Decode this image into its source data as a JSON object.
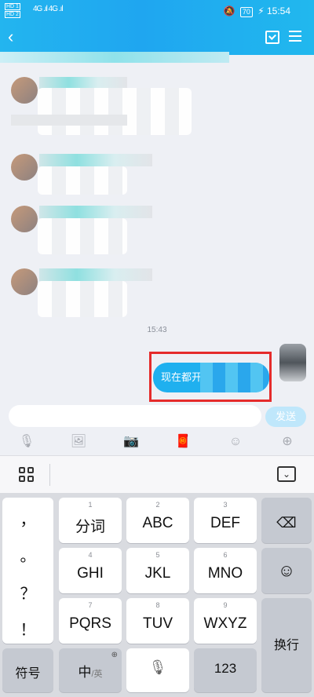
{
  "status": {
    "sim1": "HD 1",
    "sim2": "HD 2",
    "signal": "4G .ıl 4G .ıl",
    "battery": "70",
    "time": "15:54"
  },
  "nav": {
    "back": "‹"
  },
  "chat": {
    "timestamp": "15:43",
    "sent_message": "现在都开"
  },
  "input": {
    "placeholder": "",
    "send_label": "发送"
  },
  "toolbar": [
    "mic-icon",
    "image-icon",
    "camera-icon",
    "red-packet-icon",
    "emoji-icon",
    "plus-icon"
  ],
  "keyboard": {
    "punct": [
      "，",
      "。",
      "？",
      "！"
    ],
    "rows": [
      [
        {
          "num": "1",
          "label": "分词"
        },
        {
          "num": "2",
          "label": "ABC"
        },
        {
          "num": "3",
          "label": "DEF"
        }
      ],
      [
        {
          "num": "4",
          "label": "GHI"
        },
        {
          "num": "5",
          "label": "JKL"
        },
        {
          "num": "6",
          "label": "MNO"
        }
      ],
      [
        {
          "num": "7",
          "label": "PQRS"
        },
        {
          "num": "8",
          "label": "TUV"
        },
        {
          "num": "9",
          "label": "WXYZ"
        }
      ]
    ],
    "symbols": "符号",
    "lang_main": "中",
    "lang_sub": "/英",
    "numbers": "123",
    "enter": "换行"
  }
}
